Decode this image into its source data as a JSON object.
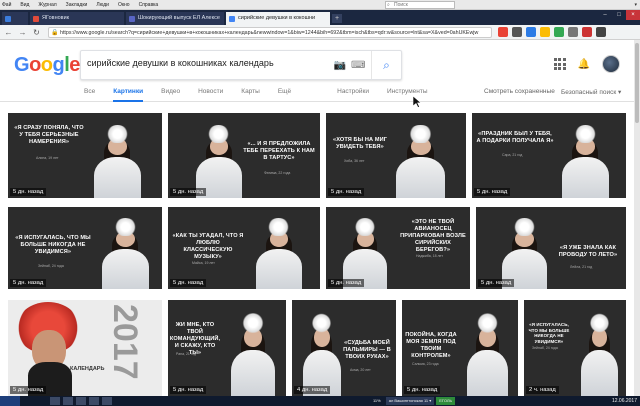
{
  "os": {
    "menu": [
      "Фай",
      "Вид",
      "Журнал",
      "Закладки",
      "Люди",
      "Окно",
      "Справка"
    ],
    "search_placeholder": "Поиск",
    "right_status": "▾"
  },
  "tabs": [
    {
      "title": "",
      "color": "#3b7ddd",
      "active": false
    },
    {
      "title": "ЯГовновик",
      "color": "#e24b3b",
      "active": false
    },
    {
      "title": "Шокирующий выпуск ЕЛ Алексе",
      "color": "#5865c4",
      "active": false
    },
    {
      "title": "сирийские девушки в кокошни",
      "color": "#4285f4",
      "active": true
    }
  ],
  "address": {
    "url": "https://www.google.ru/search?q=сирийские+девушки+в+кокошниках+календарь&newwindow=1&biw=1244&bih=692&tbm=isch&tbs=qdr:w&source=lnt&sa=X&ved=0ahUKEwjw"
  },
  "google": {
    "logo": [
      "G",
      "o",
      "o",
      "g",
      "l",
      "e"
    ],
    "query": "сирийские девушки в кокошниках календарь",
    "tabs": [
      "Все",
      "Картинки",
      "Видео",
      "Новости",
      "Карты",
      "Ещё",
      "Настройки",
      "Инструменты"
    ],
    "active_tab": "Картинки",
    "saved": "Смотреть сохраненные",
    "safe_search": "Безопасный поиск ▾"
  },
  "images": [
    {
      "quote": "«Я СРАЗУ ПОНЯЛА, ЧТО У ТЕБЯ СЕРЬЕЗНЫЕ НАМЕРЕНИЯ»",
      "sig": "Алина, 19 лет",
      "stamp": "5 дн. назад"
    },
    {
      "quote": "«... И Я ПРЕДЛОЖИЛА ТЕБЕ ПЕРЕЕХАТЬ К НАМ В ТАРТУС»",
      "sig": "Фатима, 22 года",
      "stamp": "5 дн. назад"
    },
    {
      "quote": "«ХОТЯ БЫ НА МиГ УВИДЕТЬ ТЕБЯ»",
      "sig": "Хиба, 36 лет",
      "stamp": "5 дн. назад"
    },
    {
      "quote": "«ПРАЗДНИК БЫЛ У ТЕБЯ, А ПОДАРКИ ПОЛУЧАЛА Я»",
      "sig": "Сара, 21 год",
      "stamp": "5 дн. назад"
    },
    {
      "quote": "«Я ИСПУГАЛАСЬ, ЧТО МЫ БОЛЬШЕ НИКОГДА НЕ УВИДИМСЯ»",
      "sig": "Зейнаб, 24 года",
      "stamp": "5 дн. назад"
    },
    {
      "quote": "«КАК ТЫ УГАДАЛ, ЧТО Я ЛЮБЛЮ КЛАССИЧЕСКУЮ МУЗЫКУ»",
      "sig": "Майса, 19 лет",
      "stamp": "5 дн. назад"
    },
    {
      "quote": "«ЭТО НЕ ТВОЙ АВИАНОСЕЦ ПРИПАРКОВАН ВОЗЛЕ СИРИЙСКИХ БЕРЕГОВ?»",
      "sig": "Наджиба, 18 лет",
      "stamp": "5 дн. назад"
    },
    {
      "quote": "«Я УЖЕ ЗНАЛА КАК ПРОВОДУ ТО ЛЕТО»",
      "sig": "Лейла, 21 год",
      "stamp": "5 дн. назад"
    },
    {
      "quote": "",
      "sig": "",
      "calendar_title": "КАЛЕНДАРЬ",
      "calendar_year": "2017",
      "stamp": "5 дн. назад"
    },
    {
      "quote": "ЖИ МНЕ, КТО ТВОЙ КОМАНДУЮЩИЙ, И СКАЖУ, КТО ТЫ»",
      "sig": "Рана, 21 год",
      "stamp": "5 дн. назад"
    },
    {
      "quote": "«СУДЬБА МОЕЙ ПАЛЬМИРЫ — В ТВОИХ РУКАХ»",
      "sig": "Асма, 20 лет",
      "stamp": "4 дн. назад"
    },
    {
      "quote": "ПОКОЙНА, КОГДА МОЯ ЗЕМЛЯ ПОД ТВОИМ КОНТРОЛЕМ»",
      "sig": "Сальма, 23 года",
      "stamp": "5 дн. назад"
    },
    {
      "quote": "«Я ИСПУГАЛАСЬ, ЧТО МЫ БОЛЬШЕ НИКОГДА НЕ УВИДИМСЯ»",
      "sig": "Зейнаб, 24 года",
      "stamp": "2 ч. назад"
    }
  ],
  "taskbar": {
    "tray": [
      "11%",
      "ал Вашингтонская 11 ▾",
      "ЕГОЛЬ"
    ],
    "clock": "12.06.2017"
  },
  "colors": {
    "accent": "#1a73e8",
    "photo_bg": "#2c2c2c",
    "browser_dark": "#1b2740"
  }
}
